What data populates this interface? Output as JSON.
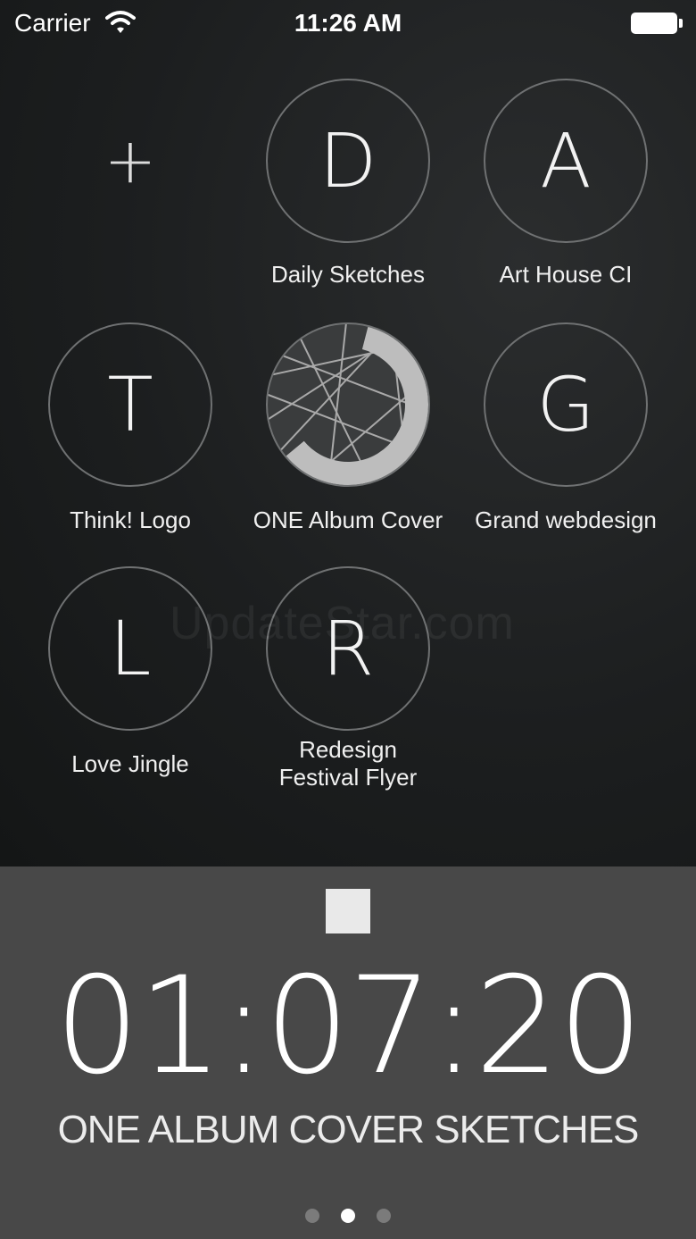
{
  "status_bar": {
    "carrier": "Carrier",
    "time": "11:26 AM",
    "wifi_icon": "wifi-icon",
    "battery_icon": "battery-icon"
  },
  "grid": {
    "add_icon": "plus-icon",
    "projects": [
      {
        "letter": "D",
        "label": "Daily Sketches"
      },
      {
        "letter": "A",
        "label": "Art House CI"
      },
      {
        "letter": "T",
        "label": "Think! Logo"
      },
      {
        "letter": "",
        "label": "ONE Album Cover",
        "active": true,
        "progress": 0.6
      },
      {
        "letter": "G",
        "label": "Grand webdesign"
      },
      {
        "letter": "L",
        "label": "Love Jingle"
      },
      {
        "letter": "R",
        "label": "Redesign Festival Flyer"
      }
    ]
  },
  "watermark": "UpdateStar.com",
  "timer": {
    "stop_icon": "stop-icon",
    "time": "01:07:20",
    "title": "ONE ALBUM COVER SKETCHES"
  },
  "pagination": {
    "pages": 3,
    "current": 2
  },
  "colors": {
    "background": "#1d2021",
    "panel": "#484848",
    "circle_border": "#6f7172",
    "progress_ring": "#bdbdbd"
  }
}
